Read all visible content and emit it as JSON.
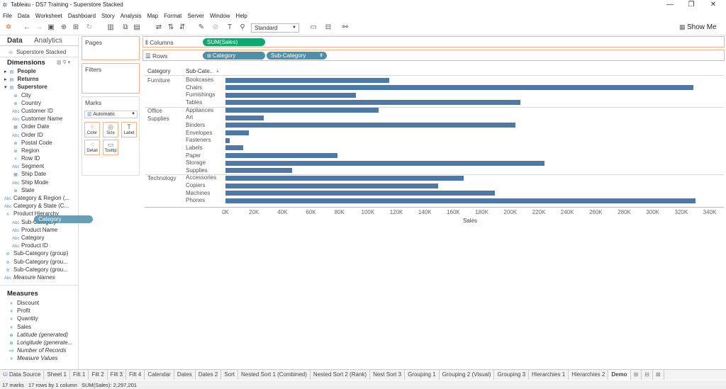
{
  "window": {
    "title": "Tableau - DS7 Training - Superstore Stacked",
    "minimize": "—",
    "maximize": "❐",
    "close": "✕"
  },
  "menu": [
    "File",
    "Data",
    "Worksheet",
    "Dashboard",
    "Story",
    "Analysis",
    "Map",
    "Format",
    "Server",
    "Window",
    "Help"
  ],
  "toolbar": {
    "fit": "Standard",
    "show_me": "Show Me"
  },
  "datapane": {
    "tab_data": "Data",
    "tab_analytics": "Analytics",
    "datasource": "Superstore Stacked",
    "dimensions_title": "Dimensions",
    "tables": [
      "People",
      "Returns",
      "Superstore"
    ],
    "dimensions": [
      "City",
      "Country",
      "Customer ID",
      "Customer Name",
      "Order Date",
      "Order ID",
      "Postal Code",
      "Region",
      "Row ID",
      "Segment",
      "Ship Date",
      "Ship Mode",
      "State",
      "Category & Region (...",
      "Category & State (C...",
      "Product Hierarchy",
      "Sub-Category",
      "Product Name",
      "Category",
      "Product ID",
      "Sub-Category (group)",
      "Sub-Category (grou...",
      "Sub-Category (grou...",
      "Measure Names"
    ],
    "measures_title": "Measures",
    "measures": [
      "Discount",
      "Profit",
      "Quantity",
      "Sales",
      "Latitude (generated)",
      "Longitude (generate...",
      "Number of Records",
      "Measure Values"
    ],
    "drag_pill": "Category"
  },
  "shelves": {
    "pages": "Pages",
    "filters": "Filters",
    "marks": "Marks",
    "mark_type": "Automatic",
    "mark_buttons": [
      "Color",
      "Size",
      "Label",
      "Detail",
      "Tooltip"
    ],
    "columns_label": "Columns",
    "rows_label": "Rows",
    "columns_pill": "SUM(Sales)",
    "rows_pills": [
      "Category",
      "Sub-Category"
    ]
  },
  "chart_data": {
    "type": "bar",
    "row_headers": [
      "Category",
      "Sub-Cate.."
    ],
    "xlabel": "Sales",
    "xlim": [
      0,
      340000
    ],
    "ticks": [
      "0K",
      "20K",
      "40K",
      "60K",
      "80K",
      "100K",
      "120K",
      "140K",
      "160K",
      "180K",
      "200K",
      "220K",
      "240K",
      "260K",
      "280K",
      "300K",
      "320K",
      "340K"
    ],
    "groups": [
      {
        "category": "Furniture",
        "items": [
          {
            "name": "Bookcases",
            "value": 114880
          },
          {
            "name": "Chairs",
            "value": 328449
          },
          {
            "name": "Furnishings",
            "value": 91705
          },
          {
            "name": "Tables",
            "value": 206966
          }
        ]
      },
      {
        "category": "Office Supplies",
        "items": [
          {
            "name": "Appliances",
            "value": 107532
          },
          {
            "name": "Art",
            "value": 27119
          },
          {
            "name": "Binders",
            "value": 203413
          },
          {
            "name": "Envelopes",
            "value": 16476
          },
          {
            "name": "Fasteners",
            "value": 3024
          },
          {
            "name": "Labels",
            "value": 12486
          },
          {
            "name": "Paper",
            "value": 78479
          },
          {
            "name": "Storage",
            "value": 223844
          },
          {
            "name": "Supplies",
            "value": 46674
          }
        ]
      },
      {
        "category": "Technology",
        "items": [
          {
            "name": "Accessories",
            "value": 167380
          },
          {
            "name": "Copiers",
            "value": 149528
          },
          {
            "name": "Machines",
            "value": 189239
          },
          {
            "name": "Phones",
            "value": 330007
          }
        ]
      }
    ]
  },
  "tabs": [
    "Data Source",
    "Sheet 1",
    "Filt 1",
    "Filt 2",
    "Filt 3",
    "Filt 4",
    "Calendar",
    "Dates",
    "Dates 2",
    "Sort",
    "Nested Sort 1 (Combined)",
    "Nested Sort 2 (Rank)",
    "Nest Sort 3",
    "Grouping 1",
    "Grouping 2 (Visual)",
    "Grouping 3",
    "Hierarchies 1",
    "Hierarchies 2",
    "Demo"
  ],
  "active_tab": "Demo",
  "status": {
    "marks": "17 marks",
    "rows": "17 rows by 1 column",
    "sum": "SUM(Sales): 2,297,201"
  }
}
